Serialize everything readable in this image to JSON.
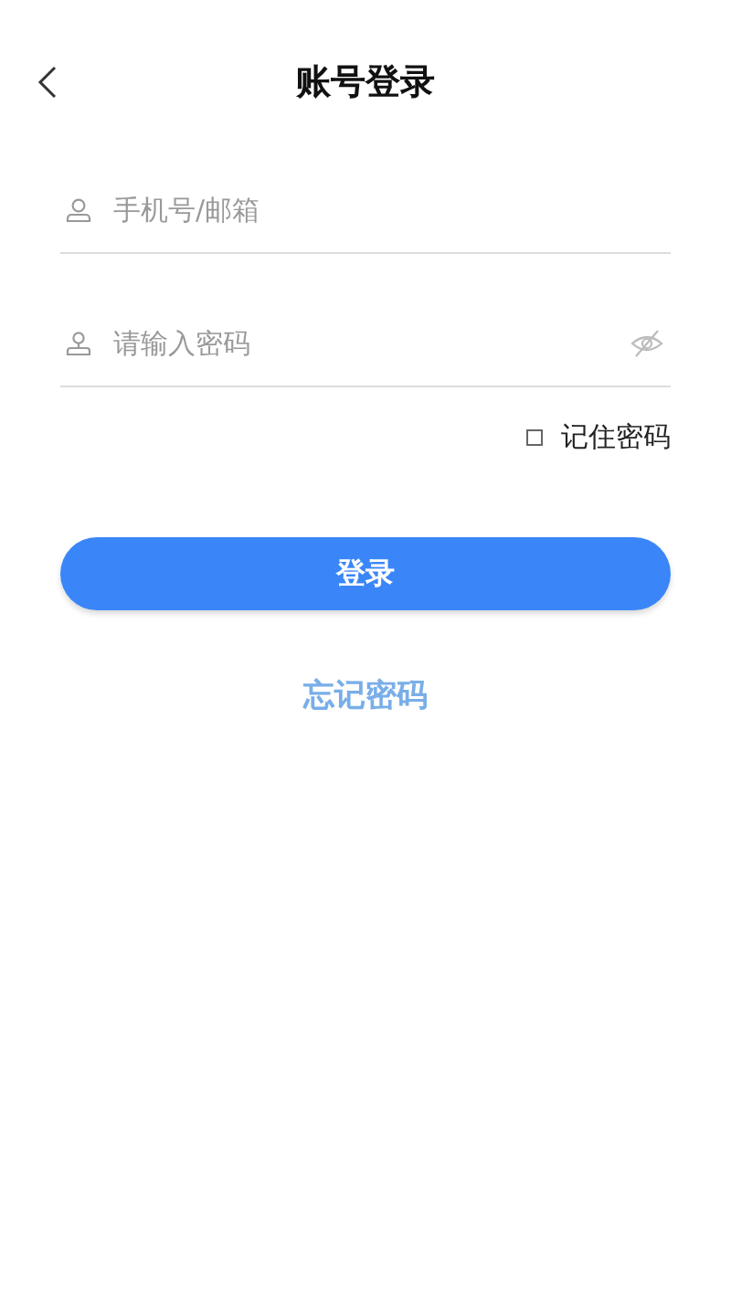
{
  "header": {
    "title": "账号登录"
  },
  "fields": [
    {
      "kind": "account",
      "placeholder": "手机号/邮箱"
    },
    {
      "kind": "password",
      "placeholder": "请输入密码",
      "password_visible": false
    }
  ],
  "remember": {
    "label": "记住密码",
    "checked": false
  },
  "login_button": "登录",
  "forgot_link": "忘记密码"
}
